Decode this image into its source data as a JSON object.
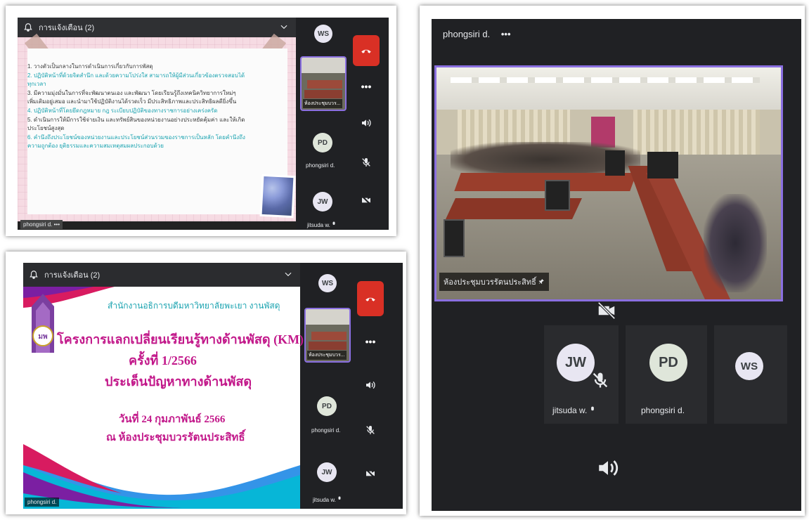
{
  "panel_a": {
    "notification": "การแจ้งเตือน (2)",
    "slide_lines": [
      {
        "text": "1. วางตัวเป็นกลางในการดำเนินการเกี่ยวกับการพัสดุ",
        "color": "#3a3a3a"
      },
      {
        "text": "2. ปฏิบัติหน้าที่ด้วยจิตสำนึก และด้วยความโปร่งใส สามารถให้ผู้มีส่วนเกี่ยวข้องตรวจสอบได้",
        "color": "#1aa3b0"
      },
      {
        "text": "ทุกเวลา",
        "color": "#1aa3b0"
      },
      {
        "text": "3. มีความมุ่งมั่นในการที่จะพัฒนาตนเอง และพัฒนา โดยเรียนรู้ถึงเทคนิควิทยาการใหม่ๆ",
        "color": "#3a3a3a"
      },
      {
        "text": "เพิ่มเติมอยู่เสมอ และนำมาใช้ปฏิบัติงานได้รวดเร็ว มีประสิทธิภาพและประสิทธิผลดียิ่งขึ้น",
        "color": "#3a3a3a"
      },
      {
        "text": "4. ปฏิบัติหน้าที่โดยยึดกฎหมาย กฎ ระเบียบปฏิบัติของทางราชการอย่างเคร่งครัด",
        "color": "#1aa3b0"
      },
      {
        "text": "5. ดำเนินการให้มีการใช้จ่ายเงิน และทรัพย์สินของหน่วยงานอย่างประหยัดคุ้มค่า และให้เกิด",
        "color": "#3a3a3a"
      },
      {
        "text": "ประโยชน์สูงสุด",
        "color": "#3a3a3a"
      },
      {
        "text": "6. คำนึงถึงประโยชน์ของหน่วยงานและประโยชน์ส่วนรวมของราชการเป็นหลัก โดยคำนึงถึง",
        "color": "#1aa3b0"
      },
      {
        "text": "ความถูกต้อง ยุติธรรมและความสมเหตุสมผลประกอบด้วย",
        "color": "#1aa3b0"
      }
    ],
    "presenter": "phongsiri d.",
    "more": "•••",
    "thumb_label": "ห้องประชุมบวร...",
    "strip": [
      {
        "initials": "WS",
        "name": ""
      },
      {
        "initials": "PD",
        "name": "phongsiri d."
      },
      {
        "initials": "JW",
        "name": "jitsuda w."
      }
    ]
  },
  "panel_b": {
    "notification": "การแจ้งเตือน (2)",
    "org": "สำนักงานอธิการบดีมหาวิทยาลัยพะเยา งานพัสดุ",
    "title1": "โครงการแลกเปลี่ยนเรียนรู้ทางด้านพัสดุ (KM)",
    "title2": "ครั้งที่ 1/2566",
    "title3": "ประเด็นปัญหาทางด้านพัสดุ",
    "date": "วันที่ 24 กุมภาพันธ์ 2566",
    "place": "ณ ห้องประชุมบวรรัตนประสิทธิ์",
    "presenter": "phongsiri d.",
    "thumb_label": "ห้องประชุมบวร...",
    "strip": [
      {
        "initials": "WS",
        "name": ""
      },
      {
        "initials": "PD",
        "name": "phongsiri d."
      },
      {
        "initials": "JW",
        "name": "jitsuda w."
      }
    ]
  },
  "panel_c": {
    "top_name": "phongsiri d.",
    "more": "•••",
    "room_label": "ห้องประชุมบวรรัตนประสิทธิ์",
    "tiles": [
      {
        "initials": "JW",
        "name": "jitsuda w."
      },
      {
        "initials": "PD",
        "name": "phongsiri d."
      },
      {
        "initials": "WS",
        "name": ""
      }
    ]
  },
  "colors": {
    "avatar_bg": "#e8e6f2",
    "avatar_text": "#3c4043",
    "pd_bg": "#dfe6da",
    "end_call": "#d93025",
    "active_border": "#8a6fe0",
    "title_magenta": "#c2188a",
    "org_teal": "#1aa3b0"
  }
}
